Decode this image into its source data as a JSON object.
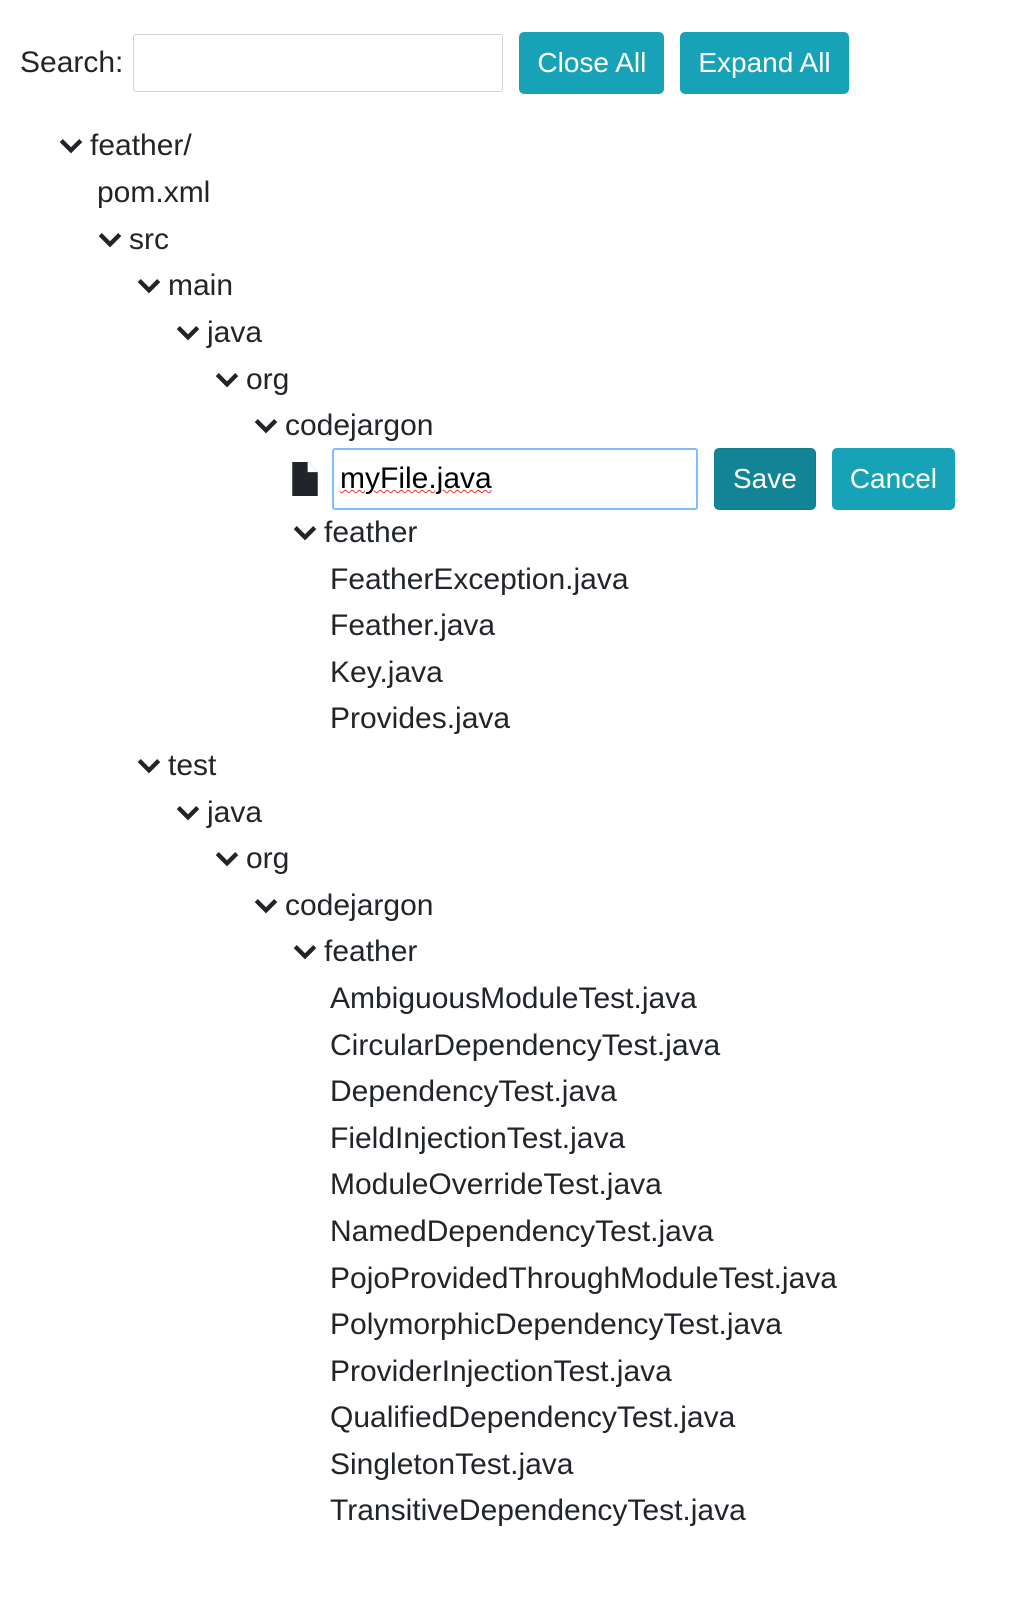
{
  "toolbar": {
    "search_label": "Search:",
    "search_value": "",
    "close_all_label": "Close All",
    "expand_all_label": "Expand All",
    "accent": "#17a2b8"
  },
  "tree": {
    "root": "feather/",
    "pom": "pom.xml",
    "src": "src",
    "main": "main",
    "main_java": "java",
    "main_org": "org",
    "main_codejargon": "codejargon",
    "new_file_value": "myFile.java",
    "save_label": "Save",
    "cancel_label": "Cancel",
    "main_feather": "feather",
    "main_files": [
      "FeatherException.java",
      "Feather.java",
      "Key.java",
      "Provides.java"
    ],
    "test": "test",
    "test_java": "java",
    "test_org": "org",
    "test_codejargon": "codejargon",
    "test_feather": "feather",
    "test_files": [
      "AmbiguousModuleTest.java",
      "CircularDependencyTest.java",
      "DependencyTest.java",
      "FieldInjectionTest.java",
      "ModuleOverrideTest.java",
      "NamedDependencyTest.java",
      "PojoProvidedThroughModuleTest.java",
      "PolymorphicDependencyTest.java",
      "ProviderInjectionTest.java",
      "QualifiedDependencyTest.java",
      "SingletonTest.java",
      "TransitiveDependencyTest.java"
    ]
  }
}
